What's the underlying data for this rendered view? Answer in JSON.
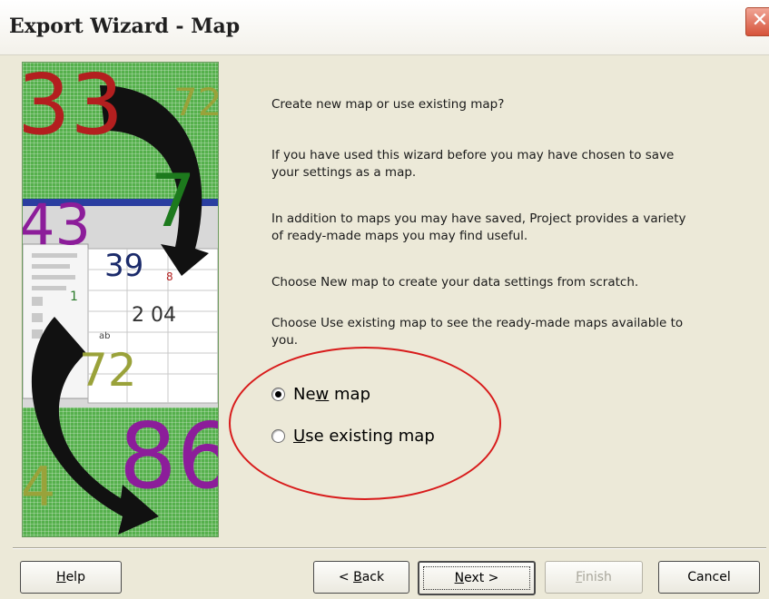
{
  "window": {
    "title": "Export Wizard - Map",
    "close_glyph": "✕"
  },
  "art": {
    "numbers": [
      "33",
      "72",
      "7",
      "43",
      "39",
      "8",
      "1",
      "2 04",
      "72",
      "86",
      "4",
      "ab"
    ]
  },
  "content": {
    "question": "Create new map or use existing map?",
    "para1": "If you have used this wizard before you may have chosen to save your settings as a map.",
    "para2": "In addition to maps you may have saved, Project provides a variety of ready-made maps you may find useful.",
    "para3": "Choose New map to create your data settings from scratch.",
    "para4": "Choose Use existing map to see the ready-made maps available to you."
  },
  "options": {
    "new_map": {
      "pre": "Ne",
      "ul": "w",
      "post": " map",
      "checked": true
    },
    "use_existing": {
      "ul": "U",
      "post": "se existing map",
      "checked": false
    }
  },
  "buttons": {
    "help": {
      "ul": "H",
      "post": "elp"
    },
    "back": {
      "pre": "< ",
      "ul": "B",
      "post": "ack"
    },
    "next": {
      "ul": "N",
      "post": "ext >"
    },
    "finish": {
      "ul": "F",
      "post": "inish"
    },
    "cancel": "Cancel"
  },
  "colors": {
    "annotation": "#d81b1b",
    "art_green": "#55b04c"
  }
}
